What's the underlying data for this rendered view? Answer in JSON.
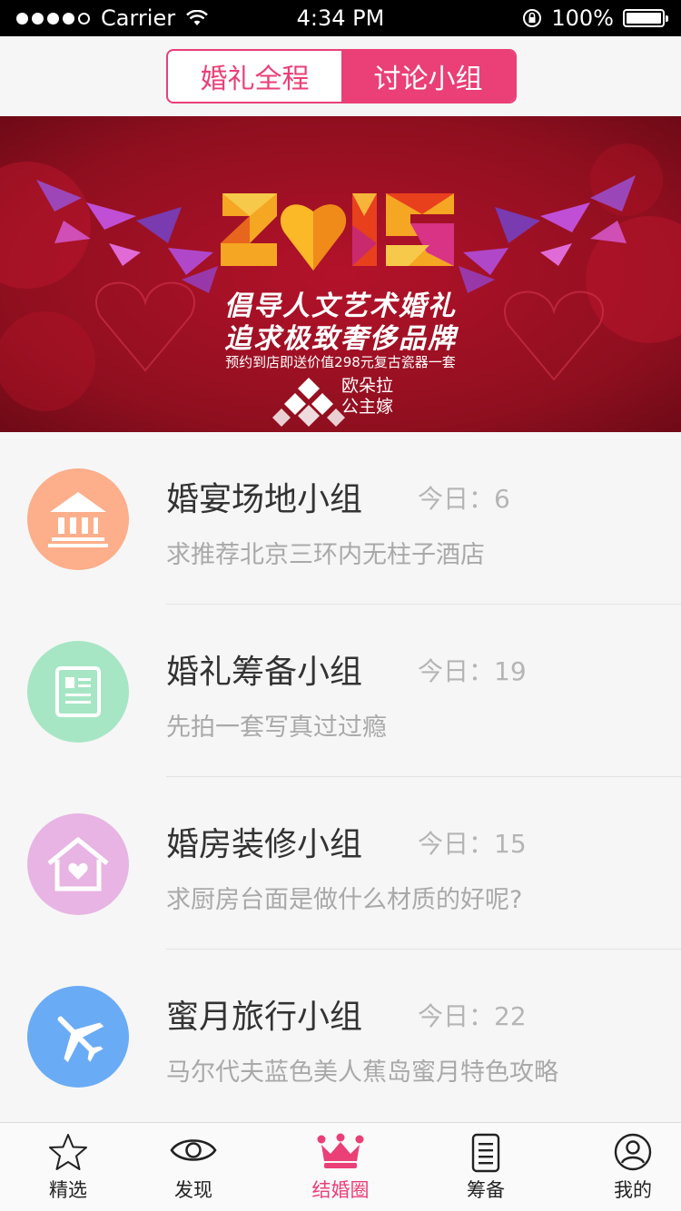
{
  "status_bar": {
    "carrier": "Carrier",
    "time": "4:34 PM",
    "battery": "100%"
  },
  "segment": {
    "tabs": [
      {
        "label": "婚礼全程",
        "active": false
      },
      {
        "label": "讨论小组",
        "active": true
      }
    ]
  },
  "banner": {
    "year": "2015",
    "slogan_line1": "倡导人文艺术婚礼",
    "slogan_line2": "追求极致奢侈品牌",
    "promo": "预约到店即送价值298元复古瓷器一套",
    "brand_line1": "欧朵拉",
    "brand_line2": "公主嫁"
  },
  "groups": [
    {
      "name": "婚宴场地小组",
      "today": "今日：6",
      "latest": "求推荐北京三环内无柱子酒店",
      "icon": "venue-icon",
      "color": "#fdae8b"
    },
    {
      "name": "婚礼筹备小组",
      "today": "今日：19",
      "latest": "先拍一套写真过过瘾",
      "icon": "document-icon",
      "color": "#a6e6c4"
    },
    {
      "name": "婚房装修小组",
      "today": "今日：15",
      "latest": "求厨房台面是做什么材质的好呢?",
      "icon": "house-heart-icon",
      "color": "#e8b4e3"
    },
    {
      "name": "蜜月旅行小组",
      "today": "今日：22",
      "latest": "马尔代夫蓝色美人蕉岛蜜月特色攻略",
      "icon": "airplane-icon",
      "color": "#6aabf6"
    }
  ],
  "tabbar": {
    "items": [
      {
        "label": "精选",
        "icon": "star-icon",
        "active": false
      },
      {
        "label": "发现",
        "icon": "eye-icon",
        "active": false
      },
      {
        "label": "结婚圈",
        "icon": "crown-icon",
        "active": true
      },
      {
        "label": "筹备",
        "icon": "checklist-icon",
        "active": false
      },
      {
        "label": "我的",
        "icon": "user-icon",
        "active": false
      }
    ]
  },
  "colors": {
    "accent": "#ea3f77",
    "banner_red": "#a3111f"
  }
}
